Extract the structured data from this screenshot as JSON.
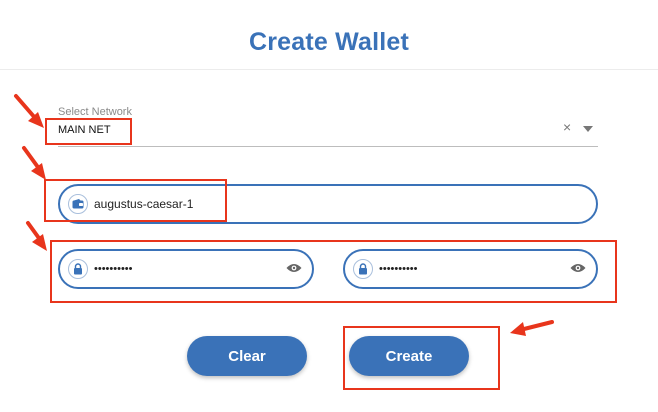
{
  "header": {
    "title": "Create Wallet"
  },
  "network": {
    "label": "Select Network",
    "value": "MAIN NET",
    "clear_glyph": "×"
  },
  "wallet_name": {
    "value": "augustus-caesar-1",
    "icon": "wallet-icon"
  },
  "password": {
    "masked_value": "••••••••••",
    "icon": "lock-icon",
    "toggle_icon": "eye-icon"
  },
  "confirm_password": {
    "masked_value": "••••••••••",
    "icon": "lock-icon",
    "toggle_icon": "eye-icon"
  },
  "actions": {
    "clear_label": "Clear",
    "create_label": "Create"
  },
  "colors": {
    "accent": "#3a72b8",
    "annotation": "#e8351c"
  }
}
